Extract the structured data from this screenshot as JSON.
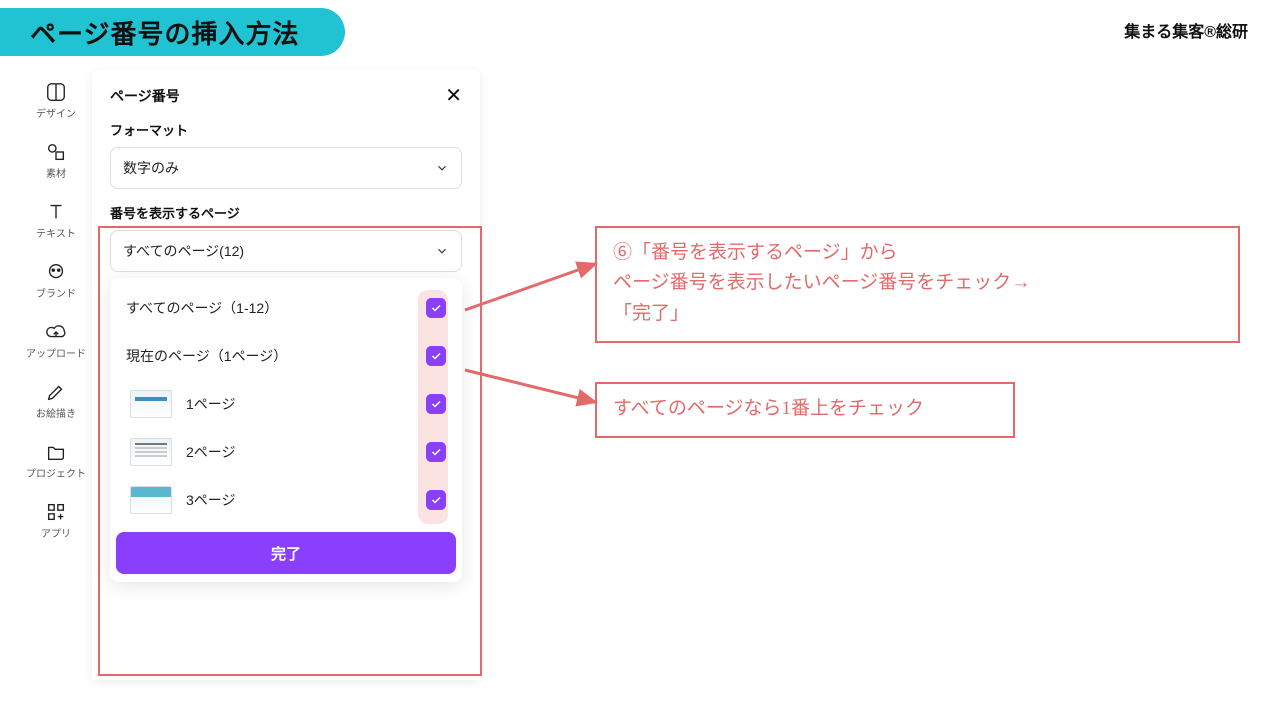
{
  "header": {
    "title": "ページ番号の挿入方法",
    "brand": "集まる集客®総研"
  },
  "sidebar": [
    {
      "key": "design",
      "label": "デザイン"
    },
    {
      "key": "elements",
      "label": "素材"
    },
    {
      "key": "text",
      "label": "テキスト"
    },
    {
      "key": "brand",
      "label": "ブランド"
    },
    {
      "key": "upload",
      "label": "アップロード"
    },
    {
      "key": "draw",
      "label": "お絵描き"
    },
    {
      "key": "project",
      "label": "プロジェクト"
    },
    {
      "key": "apps",
      "label": "アプリ"
    }
  ],
  "panel": {
    "title": "ページ番号",
    "format_label": "フォーマット",
    "format_value": "数字のみ",
    "pages_label": "番号を表示するページ",
    "pages_value": "すべてのページ(12)",
    "options": {
      "all": "すべてのページ（1-12）",
      "current": "現在のページ（1ページ）",
      "p1": "1ページ",
      "p2": "2ページ",
      "p3": "3ページ"
    },
    "done": "完了"
  },
  "callouts": {
    "c1": "⑥「番号を表示するページ」から\nページ番号を表示したいページ番号をチェック→\n「完了」",
    "c2": "すべてのページなら1番上をチェック"
  }
}
